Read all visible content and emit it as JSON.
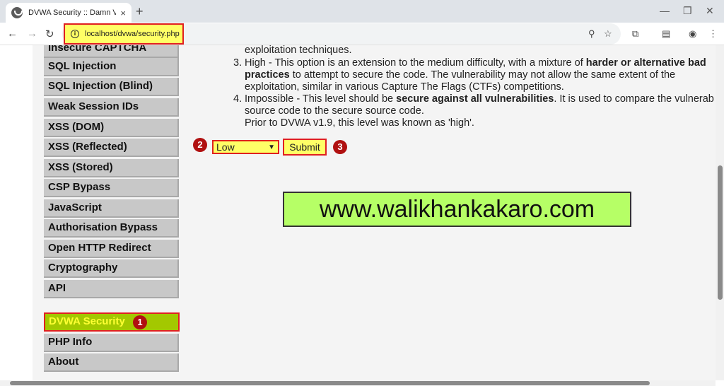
{
  "browser": {
    "tab_title": "DVWA Security :: Damn Vulnera",
    "tab_close": "×",
    "new_tab": "+",
    "url": "localhost/dvwa/security.php"
  },
  "sidebar": {
    "items": [
      {
        "label": "Insecure CAPTCHA"
      },
      {
        "label": "SQL Injection"
      },
      {
        "label": "SQL Injection (Blind)"
      },
      {
        "label": "Weak Session IDs"
      },
      {
        "label": "XSS (DOM)"
      },
      {
        "label": "XSS (Reflected)"
      },
      {
        "label": "XSS (Stored)"
      },
      {
        "label": "CSP Bypass"
      },
      {
        "label": "JavaScript"
      },
      {
        "label": "Authorisation Bypass"
      },
      {
        "label": "Open HTTP Redirect"
      },
      {
        "label": "Cryptography"
      },
      {
        "label": "API"
      },
      {
        "label": "DVWA Security"
      },
      {
        "label": "PHP Info"
      },
      {
        "label": "About"
      }
    ]
  },
  "content": {
    "line0": "exploitation techniques.",
    "item3_num": "3.",
    "item3_a": "High - This option is an extension to the medium difficulty, with a mixture of ",
    "item3_bold1": "harder or alternative bad",
    "item3_bold2": "practices",
    "item3_b": " to attempt to secure the code. The vulnerability may not allow the same extent of the",
    "item3_c": "exploitation, similar in various Capture The Flags (CTFs) competitions.",
    "item4_num": "4.",
    "item4_a": "Impossible - This level should be ",
    "item4_bold": "secure against all vulnerabilities",
    "item4_b": ". It is used to compare the vulnerab",
    "item4_c": "source code to the secure source code.",
    "item4_d": "Prior to DVWA v1.9, this level was known as 'high'.",
    "select_value": "Low",
    "submit_label": "Submit",
    "badge1": "1",
    "badge2": "2",
    "badge3": "3",
    "banner": "www.walikhankakaro.com"
  }
}
